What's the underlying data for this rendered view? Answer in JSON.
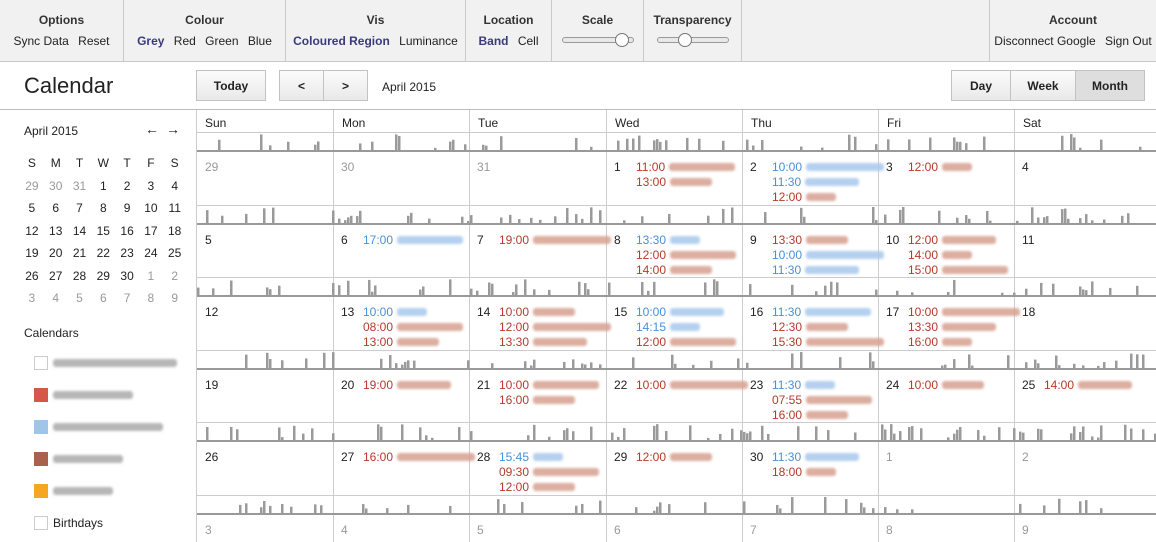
{
  "toolbar": {
    "options": {
      "title": "Options",
      "items": [
        "Sync Data",
        "Reset"
      ]
    },
    "colour": {
      "title": "Colour",
      "items": [
        "Grey",
        "Red",
        "Green",
        "Blue"
      ],
      "selected": "Grey"
    },
    "vis": {
      "title": "Vis",
      "items": [
        "Coloured Region",
        "Luminance"
      ],
      "selected": "Coloured Region"
    },
    "location": {
      "title": "Location",
      "items": [
        "Band",
        "Cell"
      ],
      "selected": "Band"
    },
    "scale": {
      "title": "Scale",
      "value": 0.9
    },
    "transparency": {
      "title": "Transparency",
      "value": 0.35
    },
    "account": {
      "title": "Account",
      "items": [
        "Disconnect Google",
        "Sign Out"
      ]
    }
  },
  "header": {
    "title": "Calendar",
    "today": "Today",
    "prev": "<",
    "next": ">",
    "period": "April 2015",
    "views": [
      "Day",
      "Week",
      "Month"
    ],
    "active_view": "Month"
  },
  "mini_calendar": {
    "title": "April 2015",
    "prev": "←",
    "next": "→",
    "weekdays": [
      "S",
      "M",
      "T",
      "W",
      "T",
      "F",
      "S"
    ],
    "weeks": [
      [
        "29",
        "30",
        "31",
        "1",
        "2",
        "3",
        "4"
      ],
      [
        "5",
        "6",
        "7",
        "8",
        "9",
        "10",
        "11"
      ],
      [
        "12",
        "13",
        "14",
        "15",
        "16",
        "17",
        "18"
      ],
      [
        "19",
        "20",
        "21",
        "22",
        "23",
        "24",
        "25"
      ],
      [
        "26",
        "27",
        "28",
        "29",
        "30",
        "1",
        "2"
      ],
      [
        "3",
        "4",
        "5",
        "6",
        "7",
        "8",
        "9"
      ]
    ]
  },
  "calendars": {
    "heading": "Calendars",
    "items": [
      {
        "color": "#ffffff",
        "label": ""
      },
      {
        "color": "#d4574a",
        "label": ""
      },
      {
        "color": "#9fc5e8",
        "label": ""
      },
      {
        "color": "#a8614a",
        "label": ""
      },
      {
        "color": "#f5a623",
        "label": ""
      },
      {
        "color": "#ffffff",
        "label": "Birthdays"
      }
    ]
  },
  "month": {
    "weekdays": [
      "Sun",
      "Mon",
      "Tue",
      "Wed",
      "Thu",
      "Fri",
      "Sat"
    ],
    "weeks": [
      {
        "days": [
          {
            "n": "29",
            "other": true,
            "events": []
          },
          {
            "n": "30",
            "other": true,
            "events": []
          },
          {
            "n": "31",
            "other": true,
            "events": []
          },
          {
            "n": "1",
            "events": [
              {
                "time": "11:00",
                "c": "red"
              },
              {
                "time": "13:00",
                "c": "red"
              }
            ]
          },
          {
            "n": "2",
            "events": [
              {
                "time": "10:00",
                "c": "blue"
              },
              {
                "time": "11:30",
                "c": "blue"
              },
              {
                "time": "12:00",
                "c": "red"
              }
            ]
          },
          {
            "n": "3",
            "events": [
              {
                "time": "12:00",
                "c": "red"
              }
            ]
          },
          {
            "n": "4",
            "events": []
          }
        ]
      },
      {
        "days": [
          {
            "n": "5",
            "events": []
          },
          {
            "n": "6",
            "events": [
              {
                "time": "17:00",
                "c": "blue"
              }
            ]
          },
          {
            "n": "7",
            "events": [
              {
                "time": "19:00",
                "c": "red"
              }
            ]
          },
          {
            "n": "8",
            "events": [
              {
                "time": "13:30",
                "c": "blue"
              },
              {
                "time": "12:00",
                "c": "red"
              },
              {
                "time": "14:00",
                "c": "red"
              }
            ]
          },
          {
            "n": "9",
            "events": [
              {
                "time": "13:30",
                "c": "red"
              },
              {
                "time": "10:00",
                "c": "blue"
              },
              {
                "time": "11:30",
                "c": "blue"
              }
            ]
          },
          {
            "n": "10",
            "events": [
              {
                "time": "12:00",
                "c": "red"
              },
              {
                "time": "14:00",
                "c": "red"
              },
              {
                "time": "15:00",
                "c": "red"
              }
            ]
          },
          {
            "n": "11",
            "events": []
          }
        ]
      },
      {
        "days": [
          {
            "n": "12",
            "events": []
          },
          {
            "n": "13",
            "events": [
              {
                "time": "10:00",
                "c": "blue"
              },
              {
                "time": "08:00",
                "c": "red"
              },
              {
                "time": "13:00",
                "c": "red"
              }
            ]
          },
          {
            "n": "14",
            "events": [
              {
                "time": "10:00",
                "c": "red"
              },
              {
                "time": "12:00",
                "c": "red"
              },
              {
                "time": "13:30",
                "c": "red"
              }
            ]
          },
          {
            "n": "15",
            "events": [
              {
                "time": "10:00",
                "c": "blue"
              },
              {
                "time": "14:15",
                "c": "blue"
              },
              {
                "time": "12:00",
                "c": "red"
              }
            ]
          },
          {
            "n": "16",
            "events": [
              {
                "time": "11:30",
                "c": "blue"
              },
              {
                "time": "12:30",
                "c": "red"
              },
              {
                "time": "15:30",
                "c": "red"
              }
            ]
          },
          {
            "n": "17",
            "events": [
              {
                "time": "10:00",
                "c": "red"
              },
              {
                "time": "13:30",
                "c": "red"
              },
              {
                "time": "16:00",
                "c": "red"
              }
            ]
          },
          {
            "n": "18",
            "events": []
          }
        ]
      },
      {
        "days": [
          {
            "n": "19",
            "events": []
          },
          {
            "n": "20",
            "events": [
              {
                "time": "19:00",
                "c": "red"
              }
            ]
          },
          {
            "n": "21",
            "events": [
              {
                "time": "10:00",
                "c": "red"
              },
              {
                "time": "16:00",
                "c": "red"
              }
            ]
          },
          {
            "n": "22",
            "events": [
              {
                "time": "10:00",
                "c": "red"
              }
            ]
          },
          {
            "n": "23",
            "events": [
              {
                "time": "11:30",
                "c": "blue"
              },
              {
                "time": "07:55",
                "c": "red"
              },
              {
                "time": "16:00",
                "c": "red"
              }
            ]
          },
          {
            "n": "24",
            "events": [
              {
                "time": "10:00",
                "c": "red"
              }
            ]
          },
          {
            "n": "25",
            "events": [
              {
                "time": "14:00",
                "c": "red"
              }
            ]
          }
        ]
      },
      {
        "days": [
          {
            "n": "26",
            "events": []
          },
          {
            "n": "27",
            "events": [
              {
                "time": "16:00",
                "c": "red"
              }
            ]
          },
          {
            "n": "28",
            "events": [
              {
                "time": "15:45",
                "c": "blue"
              },
              {
                "time": "09:30",
                "c": "red"
              },
              {
                "time": "12:00",
                "c": "red"
              }
            ]
          },
          {
            "n": "29",
            "events": [
              {
                "time": "12:00",
                "c": "red"
              }
            ]
          },
          {
            "n": "30",
            "events": [
              {
                "time": "11:30",
                "c": "blue"
              },
              {
                "time": "18:00",
                "c": "red"
              }
            ]
          },
          {
            "n": "1",
            "other": true,
            "events": []
          },
          {
            "n": "2",
            "other": true,
            "events": []
          }
        ]
      },
      {
        "days": [
          {
            "n": "3",
            "other": true,
            "events": []
          },
          {
            "n": "4",
            "other": true,
            "events": []
          },
          {
            "n": "5",
            "other": true,
            "events": []
          },
          {
            "n": "6",
            "other": true,
            "events": []
          },
          {
            "n": "7",
            "other": true,
            "events": []
          },
          {
            "n": "8",
            "other": true,
            "events": []
          },
          {
            "n": "9",
            "other": true,
            "events": []
          }
        ]
      }
    ]
  },
  "colors": {
    "red": "#b53a2a",
    "blue": "#4a8fd6",
    "histogram": "#9a9a9a",
    "selected": "#3a3a7c"
  }
}
